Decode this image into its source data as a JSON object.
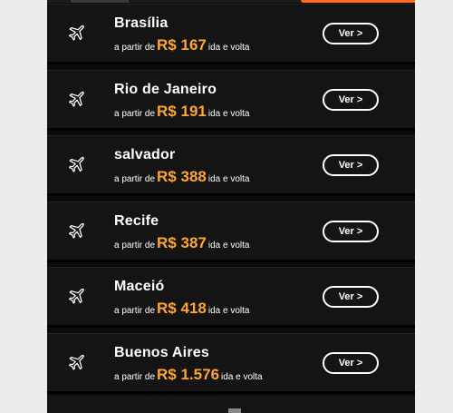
{
  "destinations": [
    {
      "city": "Brasília",
      "prefix": "a partir de",
      "price": "R$ 167",
      "suffix": "ida e volta",
      "button": "Ver >"
    },
    {
      "city": "Rio de Janeiro",
      "prefix": "a partir de",
      "price": "R$ 191",
      "suffix": "ida e volta",
      "button": "Ver >"
    },
    {
      "city": "salvador",
      "prefix": "a partir de",
      "price": "R$ 388",
      "suffix": "ida e volta",
      "button": "Ver >"
    },
    {
      "city": "Recife",
      "prefix": "a partir de",
      "price": "R$ 387",
      "suffix": "ida e volta",
      "button": "Ver >"
    },
    {
      "city": "Maceió",
      "prefix": "a partir de",
      "price": "R$ 418",
      "suffix": "ida e volta",
      "button": "Ver >"
    },
    {
      "city": "Buenos Aires",
      "prefix": "a partir de",
      "price": "R$ 1.576",
      "suffix": "ida e volta",
      "button": "Ver >"
    }
  ],
  "colors": {
    "price": "#ffa531",
    "accent_bar": "#ff6a13",
    "card_bg": "#141414",
    "panel_bg": "#0b0b0b"
  },
  "icons": {
    "destination": "airplane-icon"
  }
}
